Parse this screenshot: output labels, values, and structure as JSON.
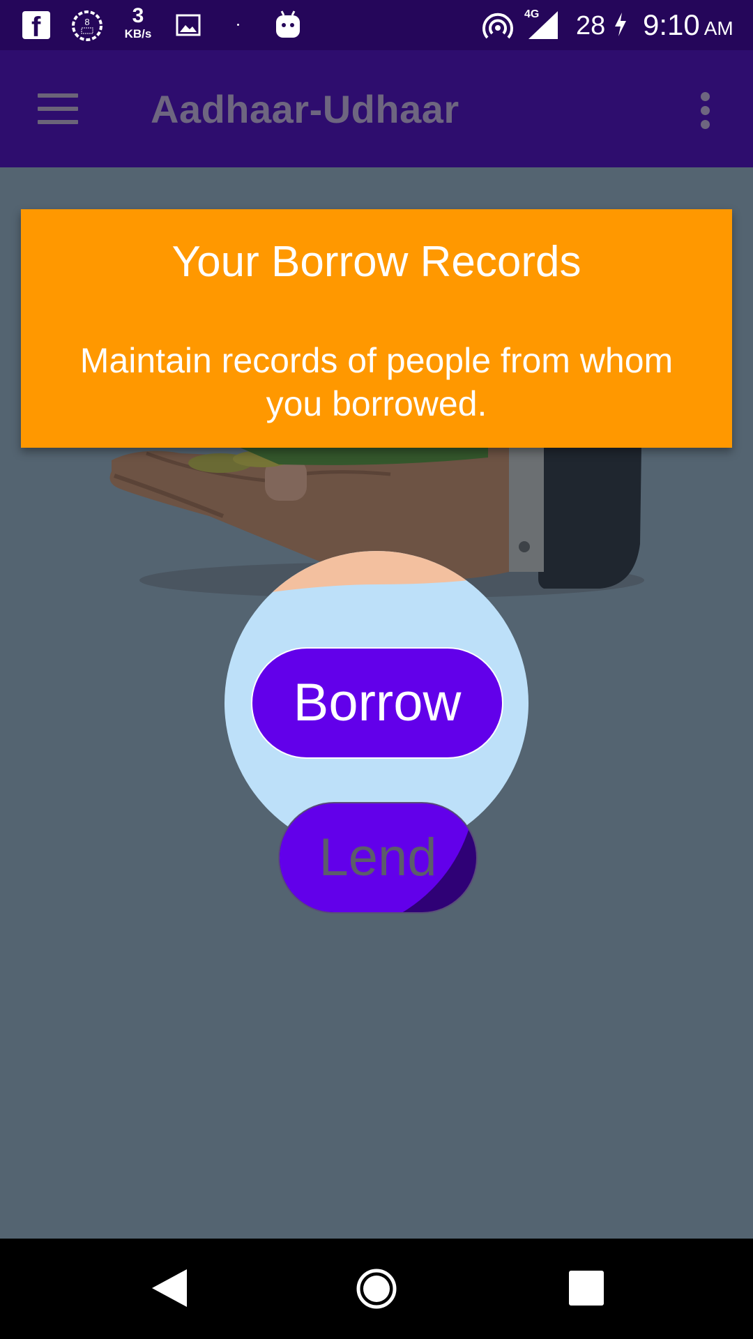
{
  "status_bar": {
    "speed_value": "3",
    "speed_unit": "KB/s",
    "network_type": "4G",
    "battery_level": "28",
    "time": "9:10",
    "time_period": "AM",
    "badge_count": "8",
    "icons": [
      "facebook-icon",
      "notification-badge-icon",
      "gallery-icon",
      "android-icon",
      "hotspot-icon",
      "signal-icon",
      "charging-icon"
    ]
  },
  "app_bar": {
    "title": "Aadhaar-Udhaar",
    "menu_icon": "hamburger-menu-icon",
    "overflow_icon": "more-vertical-icon"
  },
  "tooltip": {
    "title": "Your Borrow Records",
    "description": "Maintain records of people from whom you borrowed."
  },
  "buttons": {
    "borrow_label": "Borrow",
    "lend_label": "Lend"
  },
  "colors": {
    "status_bar": "#25065a",
    "app_bar": "#2e0d6e",
    "overlay": "#546471",
    "tooltip": "#ff9800",
    "spotlight": "#bde0f9",
    "button": "#6200ea"
  },
  "nav_bar": {
    "icons": [
      "back-icon",
      "home-icon",
      "recents-icon"
    ]
  }
}
